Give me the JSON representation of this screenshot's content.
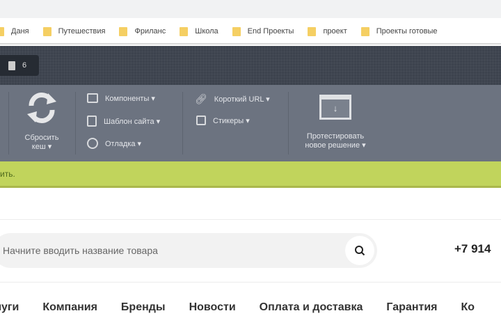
{
  "bookmarks": [
    "Даня",
    "Путешествия",
    "Фриланс",
    "Школа",
    "End Проекты",
    "проект",
    "Проекты готовые"
  ],
  "admin_button": {
    "count": "6"
  },
  "toolbar": {
    "reset_cache": [
      "Сбросить",
      "кеш ▾"
    ],
    "components": "Компоненты ▾",
    "site_template": "Шаблон сайта ▾",
    "debug": "Отладка ▾",
    "short_url": "Короткий URL ▾",
    "stickers": "Стикеры ▾",
    "test_solution": [
      "Протестировать",
      "новое решение ▾"
    ]
  },
  "notice": {
    "text": "ить."
  },
  "search": {
    "placeholder": "Начните вводить название товара"
  },
  "phone": "+7 914",
  "nav": [
    "луги",
    "Компания",
    "Бренды",
    "Новости",
    "Оплата и доставка",
    "Гарантия",
    "Ко"
  ]
}
